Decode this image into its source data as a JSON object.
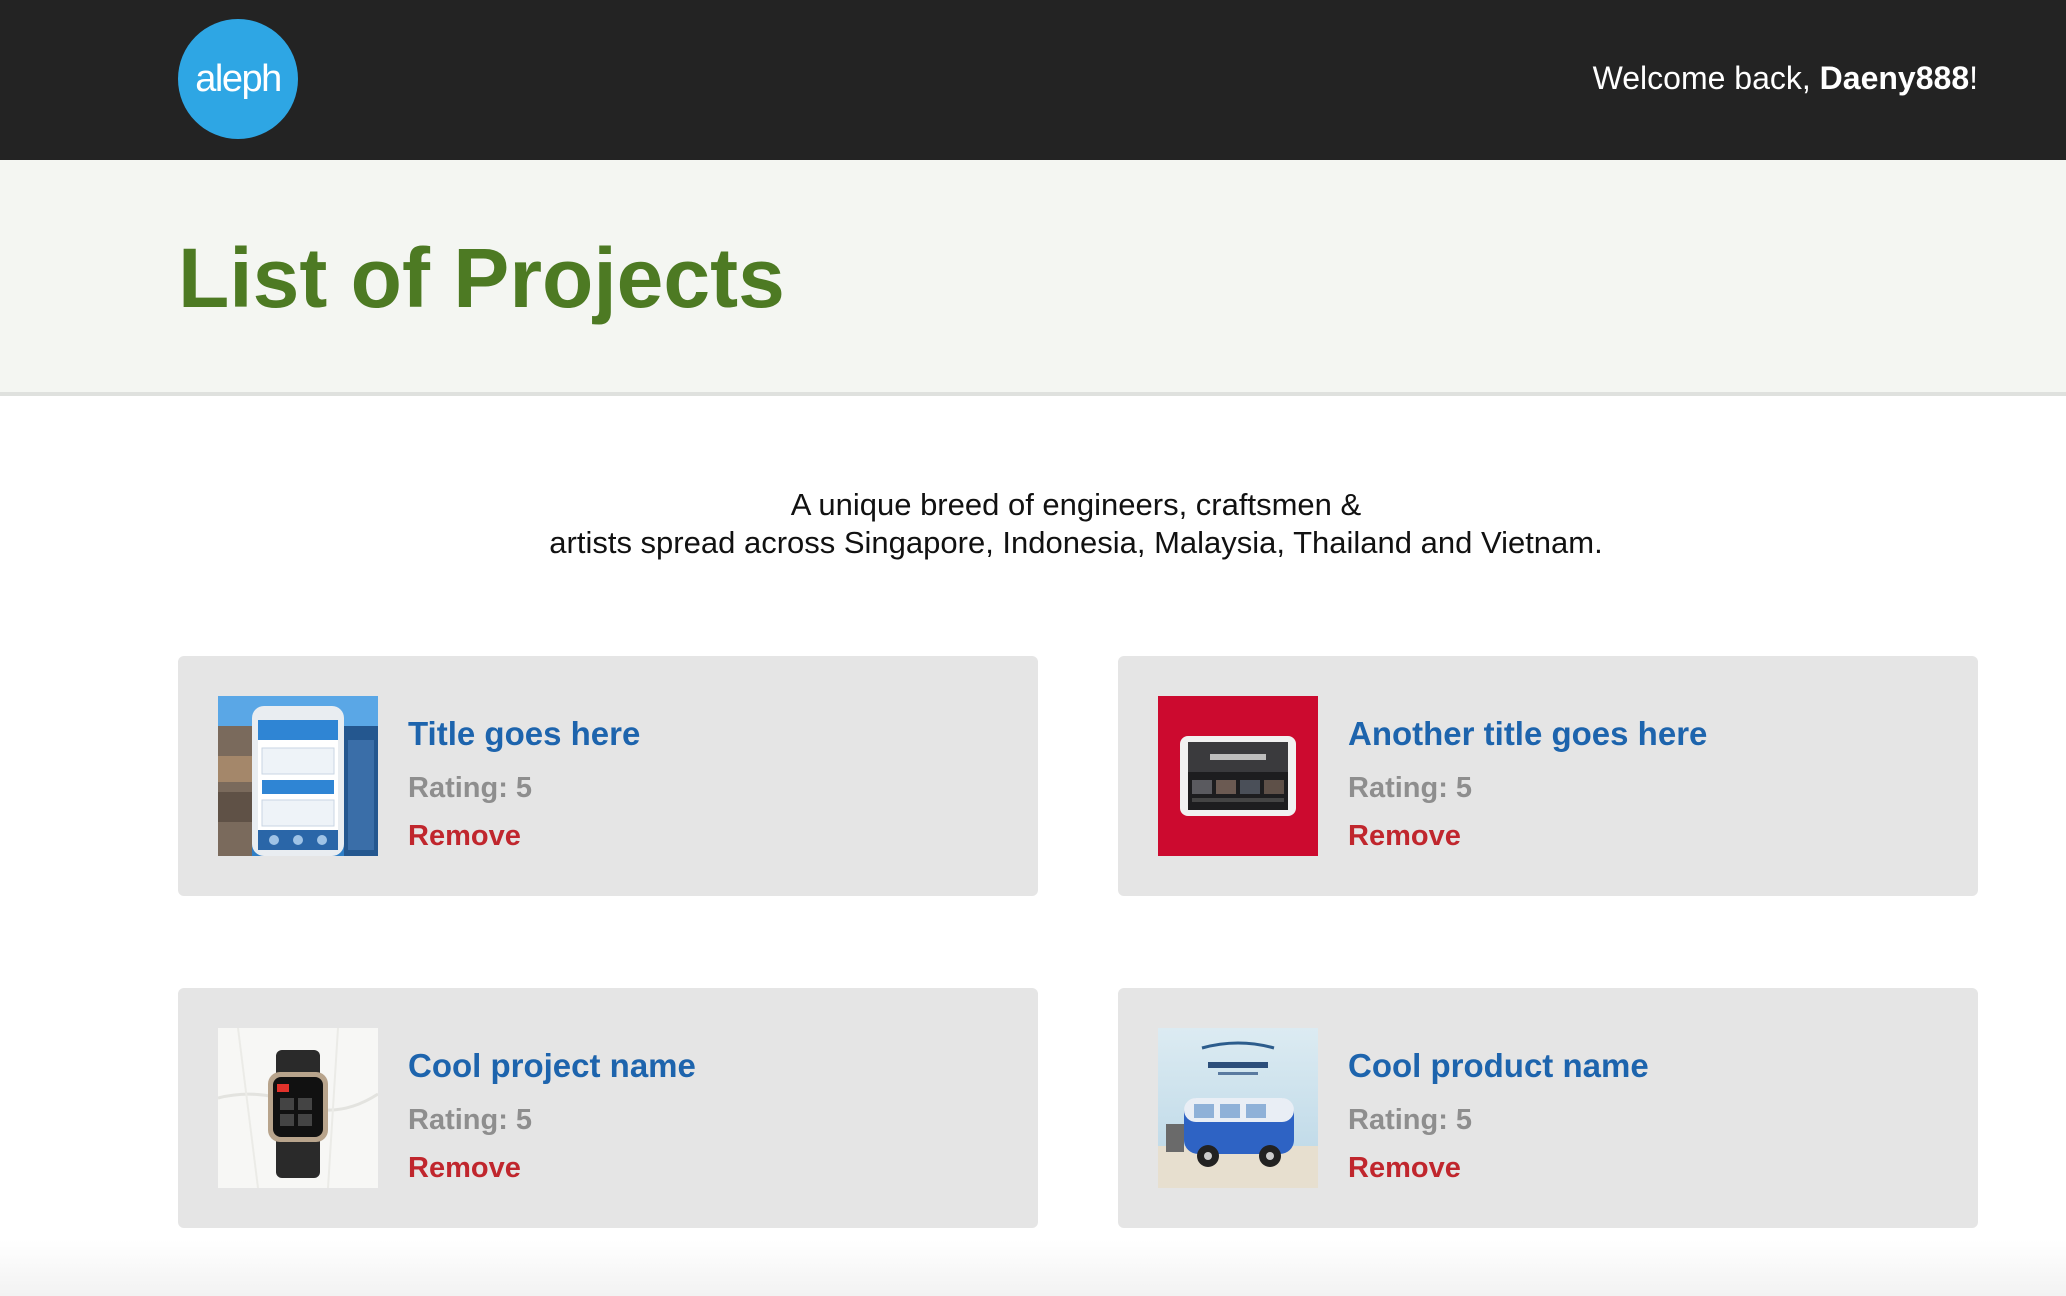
{
  "header": {
    "logo_text": "aleph",
    "welcome_prefix": "Welcome back, ",
    "username": "Daeny888",
    "welcome_suffix": "!"
  },
  "hero": {
    "title": "List of Projects"
  },
  "tagline": {
    "line1": "A unique breed of engineers, craftsmen &",
    "line2": "artists spread across Singapore, Indonesia, Malaysia, Thailand and Vietnam."
  },
  "projects": [
    {
      "title": "Title goes here",
      "rating_label": "Rating: 5",
      "remove_label": "Remove",
      "thumbnail": "mobile-app-screens-image"
    },
    {
      "title": "Another title goes here",
      "rating_label": "Rating: 5",
      "remove_label": "Remove",
      "thumbnail": "tablet-on-red-image"
    },
    {
      "title": "Cool project name",
      "rating_label": "Rating: 5",
      "remove_label": "Remove",
      "thumbnail": "smartwatch-image"
    },
    {
      "title": "Cool product name",
      "rating_label": "Rating: 5",
      "remove_label": "Remove",
      "thumbnail": "blue-van-beach-image"
    }
  ],
  "colors": {
    "header_bg": "#232323",
    "logo_bg": "#2ea6e4",
    "title_green": "#4d7a23",
    "link_blue": "#1d64ad",
    "remove_red": "#c0262d",
    "card_bg": "#e5e5e5"
  }
}
